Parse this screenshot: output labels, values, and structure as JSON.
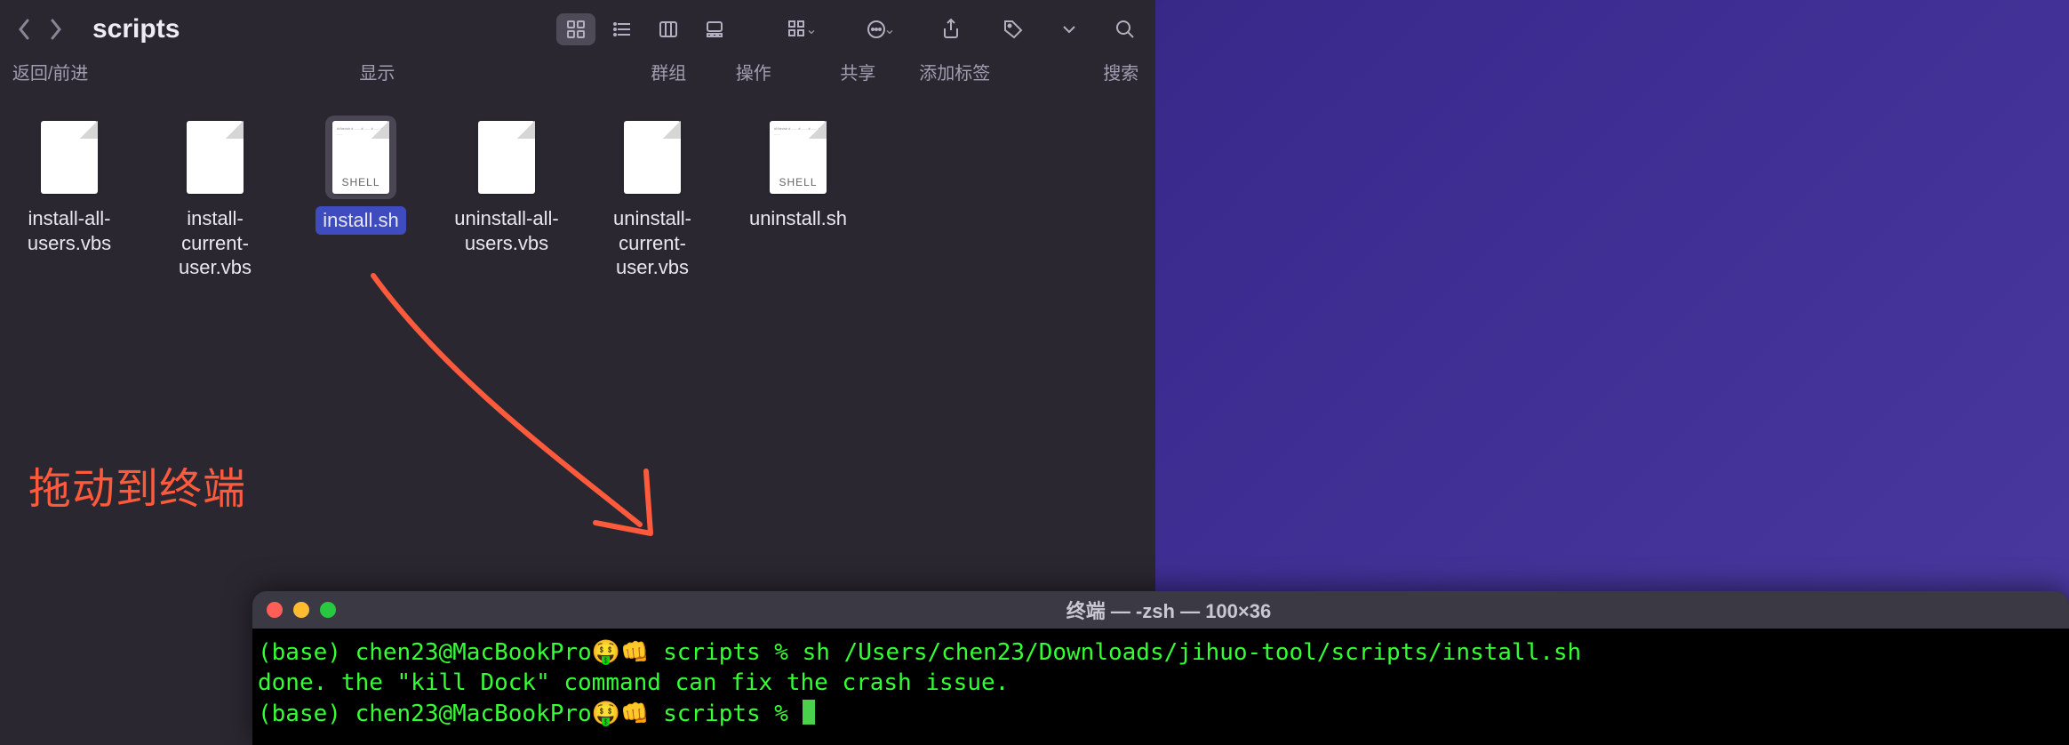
{
  "finder": {
    "title": "scripts",
    "nav_label": "返回/前进",
    "sublabels": {
      "view": "显示",
      "group": "群组",
      "action": "操作",
      "share": "共享",
      "tags": "添加标签",
      "search": "搜索"
    },
    "files": [
      {
        "name": "install-all-users.vbs",
        "type": "blank"
      },
      {
        "name": "install-current-user.vbs",
        "type": "blank"
      },
      {
        "name": "install.sh",
        "type": "shell",
        "selected": true
      },
      {
        "name": "uninstall-all-users.vbs",
        "type": "blank"
      },
      {
        "name": "uninstall-current-user.vbs",
        "type": "blank"
      },
      {
        "name": "uninstall.sh",
        "type": "shell"
      }
    ]
  },
  "annotation": {
    "text": "拖动到终端"
  },
  "terminal": {
    "title": "终端 — -zsh — 100×36",
    "line1": "(base) chen23@MacBookPro🤑👊 scripts % sh /Users/chen23/Downloads/jihuo-tool/scripts/install.sh",
    "line2": "done. the \"kill Dock\" command can fix the crash issue.",
    "line3": "(base) chen23@MacBookPro🤑👊 scripts % "
  },
  "shell_badge": "SHELL"
}
